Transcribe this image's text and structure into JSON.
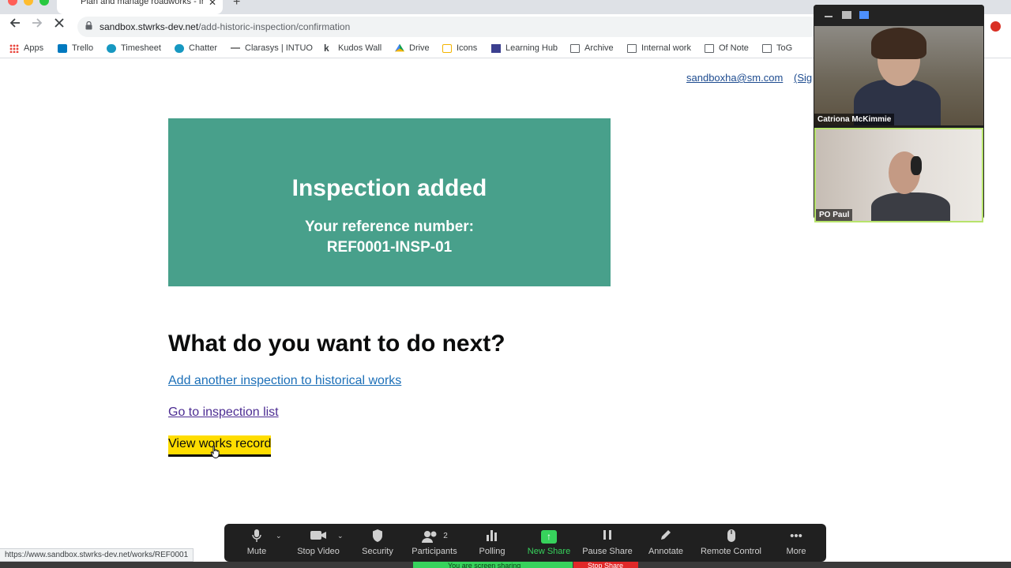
{
  "browser": {
    "tab_title": "Plan and manage roadworks - In",
    "tab_close": "✕",
    "new_tab": "+",
    "url_domain": "sandbox.stwrks-dev.net",
    "url_path": "/add-historic-inspection/confirmation",
    "bookmarks": [
      {
        "label": "Apps",
        "icon": "apps-grid-icon"
      },
      {
        "label": "Trello",
        "icon": "trello-icon"
      },
      {
        "label": "Timesheet",
        "icon": "salesforce-cloud-icon"
      },
      {
        "label": "Chatter",
        "icon": "salesforce-cloud-icon"
      },
      {
        "label": "Clarasys | INTUO",
        "icon": "intuo-icon"
      },
      {
        "label": "Kudos Wall",
        "icon": "kudos-icon"
      },
      {
        "label": "Drive",
        "icon": "drive-icon"
      },
      {
        "label": "Icons",
        "icon": "icons-folder-icon"
      },
      {
        "label": "Learning Hub",
        "icon": "learning-hub-icon"
      },
      {
        "label": "Archive",
        "icon": "folder-icon"
      },
      {
        "label": "Internal work",
        "icon": "folder-icon"
      },
      {
        "label": "Of Note",
        "icon": "folder-icon"
      },
      {
        "label": "ToG",
        "icon": "folder-icon"
      }
    ],
    "status_url": "https://www.sandbox.stwrks-dev.net/works/REF0001"
  },
  "header": {
    "account_email": "sandboxha@sm.com",
    "signout_label": "(Sig"
  },
  "confirmation": {
    "title": "Inspection added",
    "ref_label": "Your reference number:",
    "ref_number": "REF0001-INSP-01",
    "color": "#48a08b"
  },
  "next": {
    "heading": "What do you want to do next?",
    "link_add": "Add another inspection to historical works",
    "link_list": "Go to inspection list",
    "link_view": "View works record"
  },
  "video": {
    "participant_1": "Catriona McKimmie",
    "participant_2": "PO Paul"
  },
  "zoom_toolbar": {
    "mute": "Mute",
    "stop_video": "Stop Video",
    "security": "Security",
    "participants": "Participants",
    "participants_count": "2",
    "polling": "Polling",
    "new_share": "New Share",
    "pause_share": "Pause Share",
    "annotate": "Annotate",
    "remote_control": "Remote Control",
    "more": "More",
    "sharing_text": "You are screen sharing",
    "stop_share": "Stop Share"
  }
}
